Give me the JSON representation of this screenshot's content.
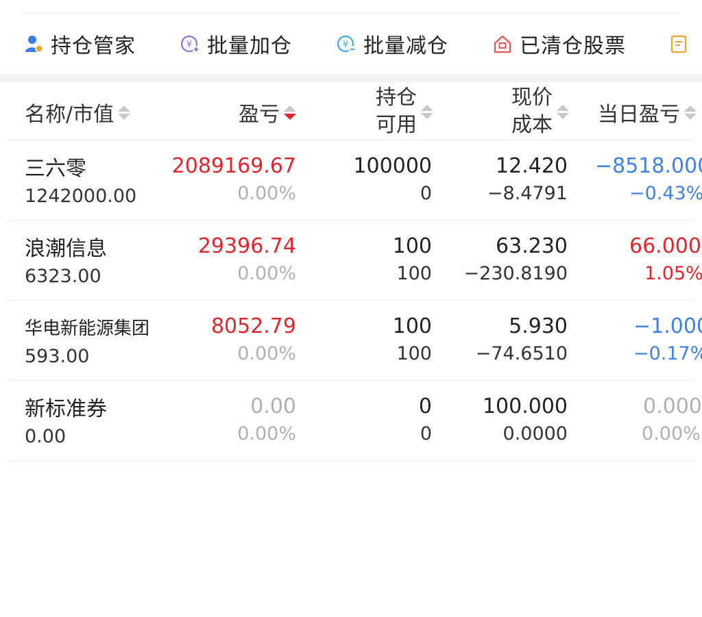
{
  "toolbar": {
    "items": [
      {
        "label": "持仓管家",
        "icon": "user-icon"
      },
      {
        "label": "批量加仓",
        "icon": "yuan-plus-icon"
      },
      {
        "label": "批量减仓",
        "icon": "yuan-minus-icon"
      },
      {
        "label": "已清仓股票",
        "icon": "house-icon"
      }
    ],
    "partial_icon": "document-icon"
  },
  "table": {
    "headers": {
      "name_mv": "名称/市值",
      "pnl": "盈亏",
      "position_top": "持仓",
      "position_bottom": "可用",
      "price_top": "现价",
      "price_bottom": "成本",
      "day_pnl": "当日盈亏"
    },
    "sort_active": "pnl-desc",
    "rows": [
      {
        "name": "三六零",
        "market_value": "1242000.00",
        "pnl": "2089169.67",
        "pnl_pct": "0.00%",
        "position": "100000",
        "available": "0",
        "price": "12.420",
        "cost": "−8.4791",
        "day_pnl": "−8518.000",
        "day_pnl_pct": "−0.43%",
        "tone": "neg"
      },
      {
        "name": "浪潮信息",
        "market_value": "6323.00",
        "pnl": "29396.74",
        "pnl_pct": "0.00%",
        "position": "100",
        "available": "100",
        "price": "63.230",
        "cost": "−230.8190",
        "day_pnl": "66.000",
        "day_pnl_pct": "1.05%",
        "tone": "pos"
      },
      {
        "name": "华电新能源集团",
        "market_value": "593.00",
        "pnl": "8052.79",
        "pnl_pct": "0.00%",
        "position": "100",
        "available": "100",
        "price": "5.930",
        "cost": "−74.6510",
        "day_pnl": "−1.000",
        "day_pnl_pct": "−0.17%",
        "tone": "neg"
      },
      {
        "name": "新标准券",
        "market_value": "0.00",
        "pnl": "0.00",
        "pnl_pct": "0.00%",
        "position": "0",
        "available": "0",
        "price": "100.000",
        "cost": "0.0000",
        "day_pnl": "0.000",
        "day_pnl_pct": "0.00%",
        "tone": "zero"
      }
    ]
  },
  "colors": {
    "up": "#e0262c",
    "down": "#3e82e4",
    "muted": "#b0b0b0"
  }
}
